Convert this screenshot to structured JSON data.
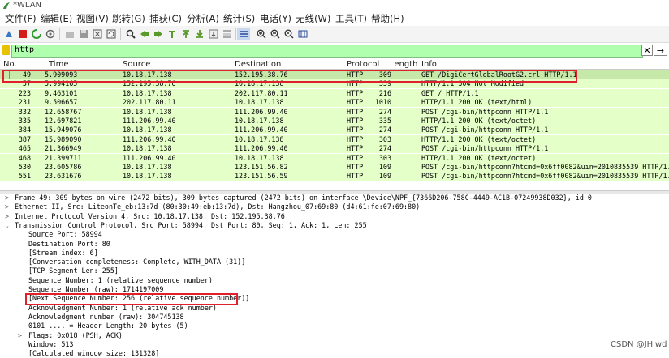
{
  "window": {
    "title": "*WLAN"
  },
  "menu": [
    "文件(F)",
    "编辑(E)",
    "视图(V)",
    "跳转(G)",
    "捕获(C)",
    "分析(A)",
    "统计(S)",
    "电话(Y)",
    "无线(W)",
    "工具(T)",
    "帮助(H)"
  ],
  "filter": {
    "value": "http"
  },
  "columns": [
    "No.",
    "Time",
    "Source",
    "Destination",
    "Protocol",
    "Length",
    "Info"
  ],
  "packets": [
    {
      "no": "49",
      "time": "5.909093",
      "src": "10.18.17.138",
      "dst": "152.195.38.76",
      "proto": "HTTP",
      "len": "309",
      "info": "GET /DigiCertGlobalRootG2.crl HTTP/1.1"
    },
    {
      "no": "57",
      "time": "5.994165",
      "src": "152.195.38.76",
      "dst": "10.18.17.138",
      "proto": "HTTP",
      "len": "339",
      "info": "HTTP/1.1 304 Not Modified"
    },
    {
      "no": "223",
      "time": "9.463101",
      "src": "10.18.17.138",
      "dst": "202.117.80.11",
      "proto": "HTTP",
      "len": "216",
      "info": "GET / HTTP/1.1"
    },
    {
      "no": "231",
      "time": "9.506657",
      "src": "202.117.80.11",
      "dst": "10.18.17.138",
      "proto": "HTTP",
      "len": "1010",
      "info": "HTTP/1.1 200 OK  (text/html)"
    },
    {
      "no": "332",
      "time": "12.658767",
      "src": "10.18.17.138",
      "dst": "111.206.99.40",
      "proto": "HTTP",
      "len": "274",
      "info": "POST /cgi-bin/httpconn HTTP/1.1"
    },
    {
      "no": "335",
      "time": "12.697821",
      "src": "111.206.99.40",
      "dst": "10.18.17.138",
      "proto": "HTTP",
      "len": "335",
      "info": "HTTP/1.1 200 OK  (text/octet)"
    },
    {
      "no": "384",
      "time": "15.949076",
      "src": "10.18.17.138",
      "dst": "111.206.99.40",
      "proto": "HTTP",
      "len": "274",
      "info": "POST /cgi-bin/httpconn HTTP/1.1"
    },
    {
      "no": "387",
      "time": "15.989090",
      "src": "111.206.99.40",
      "dst": "10.18.17.138",
      "proto": "HTTP",
      "len": "303",
      "info": "HTTP/1.1 200 OK  (text/octet)"
    },
    {
      "no": "465",
      "time": "21.366949",
      "src": "10.18.17.138",
      "dst": "111.206.99.40",
      "proto": "HTTP",
      "len": "274",
      "info": "POST /cgi-bin/httpconn HTTP/1.1"
    },
    {
      "no": "468",
      "time": "21.399711",
      "src": "111.206.99.40",
      "dst": "10.18.17.138",
      "proto": "HTTP",
      "len": "303",
      "info": "HTTP/1.1 200 OK  (text/octet)"
    },
    {
      "no": "530",
      "time": "23.605786",
      "src": "10.18.17.138",
      "dst": "123.151.56.82",
      "proto": "HTTP",
      "len": "109",
      "info": "POST /cgi-bin/httpconn?htcmd=0x6ff0082&uin=2010835539 HTTP/1.1"
    },
    {
      "no": "551",
      "time": "23.631676",
      "src": "10.18.17.138",
      "dst": "123.151.56.59",
      "proto": "HTTP",
      "len": "109",
      "info": "POST /cgi-bin/httpconn?htcmd=0x6ff0082&uin=2010835539 HTTP/1.1"
    }
  ],
  "details": [
    {
      "caret": ">",
      "indent": 0,
      "text": "Frame 49: 309 bytes on wire (2472 bits), 309 bytes captured (2472 bits) on interface \\Device\\NPF_{7366D206-758C-4449-AC1B-07249938D032}, id 0"
    },
    {
      "caret": ">",
      "indent": 0,
      "text": "Ethernet II, Src: LiteonTe_eb:13:7d (80:30:49:eb:13:7d), Dst: Hangzhou_07:69:80 (d4:61:fe:07:69:80)"
    },
    {
      "caret": ">",
      "indent": 0,
      "text": "Internet Protocol Version 4, Src: 10.18.17.138, Dst: 152.195.38.76"
    },
    {
      "caret": "v",
      "indent": 0,
      "text": "Transmission Control Protocol, Src Port: 58994, Dst Port: 80, Seq: 1, Ack: 1, Len: 255"
    },
    {
      "caret": "",
      "indent": 1,
      "text": "Source Port: 58994"
    },
    {
      "caret": "",
      "indent": 1,
      "text": "Destination Port: 80"
    },
    {
      "caret": "",
      "indent": 1,
      "text": "[Stream index: 6]"
    },
    {
      "caret": "",
      "indent": 1,
      "text": "[Conversation completeness: Complete, WITH_DATA (31)]"
    },
    {
      "caret": "",
      "indent": 1,
      "text": "[TCP Segment Len: 255]"
    },
    {
      "caret": "",
      "indent": 1,
      "text": "Sequence Number: 1    (relative sequence number)"
    },
    {
      "caret": "",
      "indent": 1,
      "text": "Sequence Number (raw): 1714197009"
    },
    {
      "caret": "",
      "indent": 1,
      "text": "[Next Sequence Number: 256    (relative sequence number)]"
    },
    {
      "caret": "",
      "indent": 1,
      "text": "Acknowledgment Number: 1    (relative ack number)"
    },
    {
      "caret": "",
      "indent": 1,
      "text": "Acknowledgment number (raw): 304745138"
    },
    {
      "caret": "",
      "indent": 1,
      "text": "0101 .... = Header Length: 20 bytes (5)"
    },
    {
      "caret": ">",
      "indent": 1,
      "text": "Flags: 0x018 (PSH, ACK)"
    },
    {
      "caret": "",
      "indent": 1,
      "text": "Window: 513"
    },
    {
      "caret": "",
      "indent": 1,
      "text": "[Calculated window size: 131328]"
    }
  ],
  "watermark": "CSDN @JHlwd",
  "colors": {
    "row_bg": "#e4ffc7",
    "selected_row_bg": "#c6e8a8",
    "filter_bg": "#afffaf",
    "highlight_box": "#e0202a"
  }
}
